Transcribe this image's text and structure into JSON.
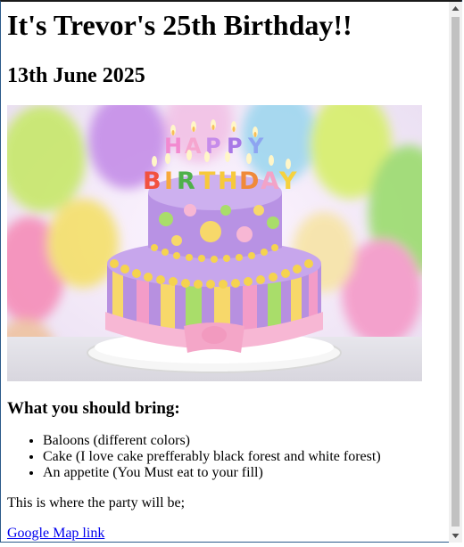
{
  "page": {
    "title": "It's Trevor's 25th Birthday!!",
    "date": "13th June 2025",
    "image_alt": "Birthday cake with Happy Birthday candles",
    "cake_topper_letters_happy": [
      "H",
      "A",
      "P",
      "P",
      "Y"
    ],
    "cake_topper_letters_birthday": [
      "B",
      "I",
      "R",
      "T",
      "H",
      "D",
      "A",
      "Y"
    ],
    "bring_heading": "What you should bring:",
    "bring_items": [
      "Baloons (different colors)",
      "Cake (I love cake prefferably black forest and white forest)",
      "An appetite (You Must eat to your fill)"
    ],
    "location_text": "This is where the party will be;",
    "map_link_text": "Google Map link"
  },
  "colors": {
    "link": "#0000ee",
    "scrollbar_thumb": "#c1c1c1",
    "scrollbar_track": "#f0f0f0"
  }
}
